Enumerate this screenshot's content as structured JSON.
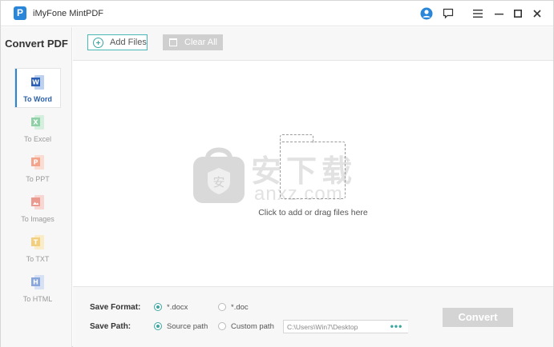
{
  "titlebar": {
    "app_title": "iMyFone MintPDF",
    "logo_letter": "P"
  },
  "sidebar": {
    "title": "Convert PDF",
    "items": [
      {
        "label": "To Word",
        "color": "#2b5fb4",
        "active": true
      },
      {
        "label": "To Excel",
        "color": "#8fd0a6",
        "active": false
      },
      {
        "label": "To PPT",
        "color": "#f2a48c",
        "active": false
      },
      {
        "label": "To Images",
        "color": "#eb9a8f",
        "active": false
      },
      {
        "label": "To TXT",
        "color": "#f2cf7e",
        "active": false
      },
      {
        "label": "To HTML",
        "color": "#8aa7db",
        "active": false
      }
    ]
  },
  "toolbar": {
    "add_files_label": "Add Files",
    "clear_all_label": "Clear All"
  },
  "drop_area": {
    "hint": "Click to add or drag files here",
    "watermark_text": "安下载",
    "watermark_sub": "anxz.com",
    "watermark_glyph": "安"
  },
  "options": {
    "save_format_label": "Save Format:",
    "format_options": [
      {
        "label": "*.docx",
        "checked": true
      },
      {
        "label": "*.doc",
        "checked": false
      }
    ],
    "save_path_label": "Save Path:",
    "path_options": [
      {
        "label": "Source path",
        "checked": true
      },
      {
        "label": "Custom path",
        "checked": false
      }
    ],
    "path_value": "C:\\Users\\Win7\\Desktop",
    "browse_label": "•••",
    "convert_label": "Convert"
  },
  "colors": {
    "accent": "#3aa6a2",
    "brand": "#2a86d8"
  }
}
